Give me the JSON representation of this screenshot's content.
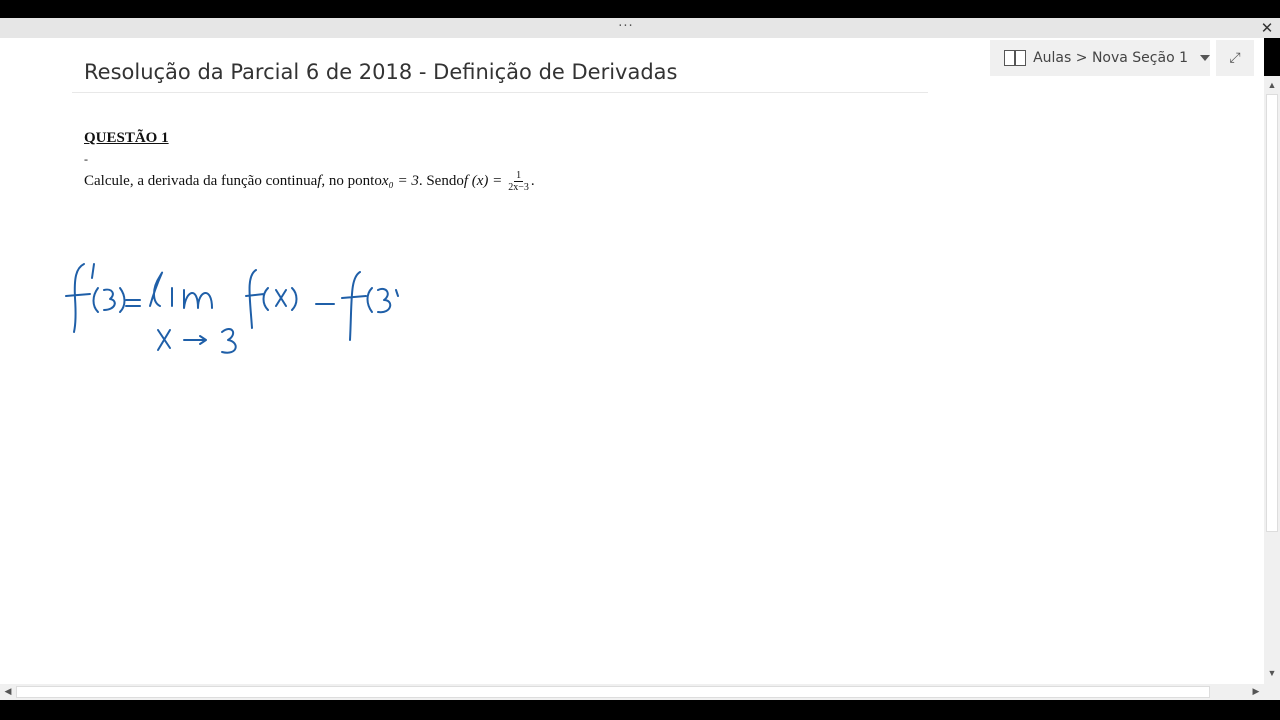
{
  "window": {
    "menu_dots": "···",
    "close_label": "✕"
  },
  "notebook": {
    "breadcrumb": "Aulas > Nova Seção 1",
    "expand_label": "⤢"
  },
  "page": {
    "title": "Resolução da Parcial 6 de 2018 - Definição de Derivadas",
    "question_heading": "QUESTÃO 1",
    "dash": "-",
    "question_prefix": "Calcule, a derivada da função continua ",
    "question_f": "f",
    "question_mid": ", no ponto ",
    "question_point": "x₀ = 3",
    "question_mid2": ". Sendo ",
    "question_func": "f (x) =",
    "fraction_num": "1",
    "fraction_den": "2x−3",
    "question_end": "."
  },
  "ink": {
    "color": "#1f5fa8",
    "strokes_description": [
      "f'(3)=",
      "lim",
      "f(x)",
      "−",
      "f(3",
      "x→3"
    ]
  },
  "scrollbars": {
    "up": "▲",
    "down": "▼",
    "left": "◀",
    "right": "▶"
  }
}
